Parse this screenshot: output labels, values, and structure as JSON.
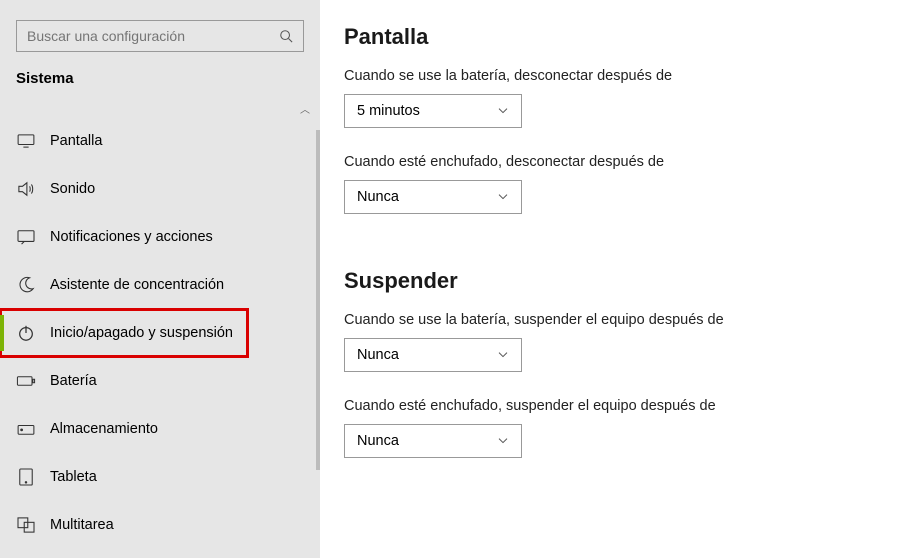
{
  "search": {
    "placeholder": "Buscar una configuración"
  },
  "sectionTitle": "Sistema",
  "nav": [
    {
      "label": "Pantalla",
      "icon": "display"
    },
    {
      "label": "Sonido",
      "icon": "sound"
    },
    {
      "label": "Notificaciones y acciones",
      "icon": "notifications"
    },
    {
      "label": "Asistente de concentración",
      "icon": "focus"
    },
    {
      "label": "Inicio/apagado y suspensión",
      "icon": "power",
      "active": true
    },
    {
      "label": "Batería",
      "icon": "battery"
    },
    {
      "label": "Almacenamiento",
      "icon": "storage"
    },
    {
      "label": "Tableta",
      "icon": "tablet"
    },
    {
      "label": "Multitarea",
      "icon": "multitask"
    }
  ],
  "main": {
    "section1": {
      "title": "Pantalla",
      "field1": {
        "label": "Cuando se use la batería, desconectar después de",
        "value": "5 minutos"
      },
      "field2": {
        "label": "Cuando esté enchufado, desconectar después de",
        "value": "Nunca"
      }
    },
    "section2": {
      "title": "Suspender",
      "field1": {
        "label": "Cuando se use la batería, suspender el equipo después de",
        "value": "Nunca"
      },
      "field2": {
        "label": "Cuando esté enchufado, suspender el equipo después de",
        "value": "Nunca"
      }
    }
  }
}
